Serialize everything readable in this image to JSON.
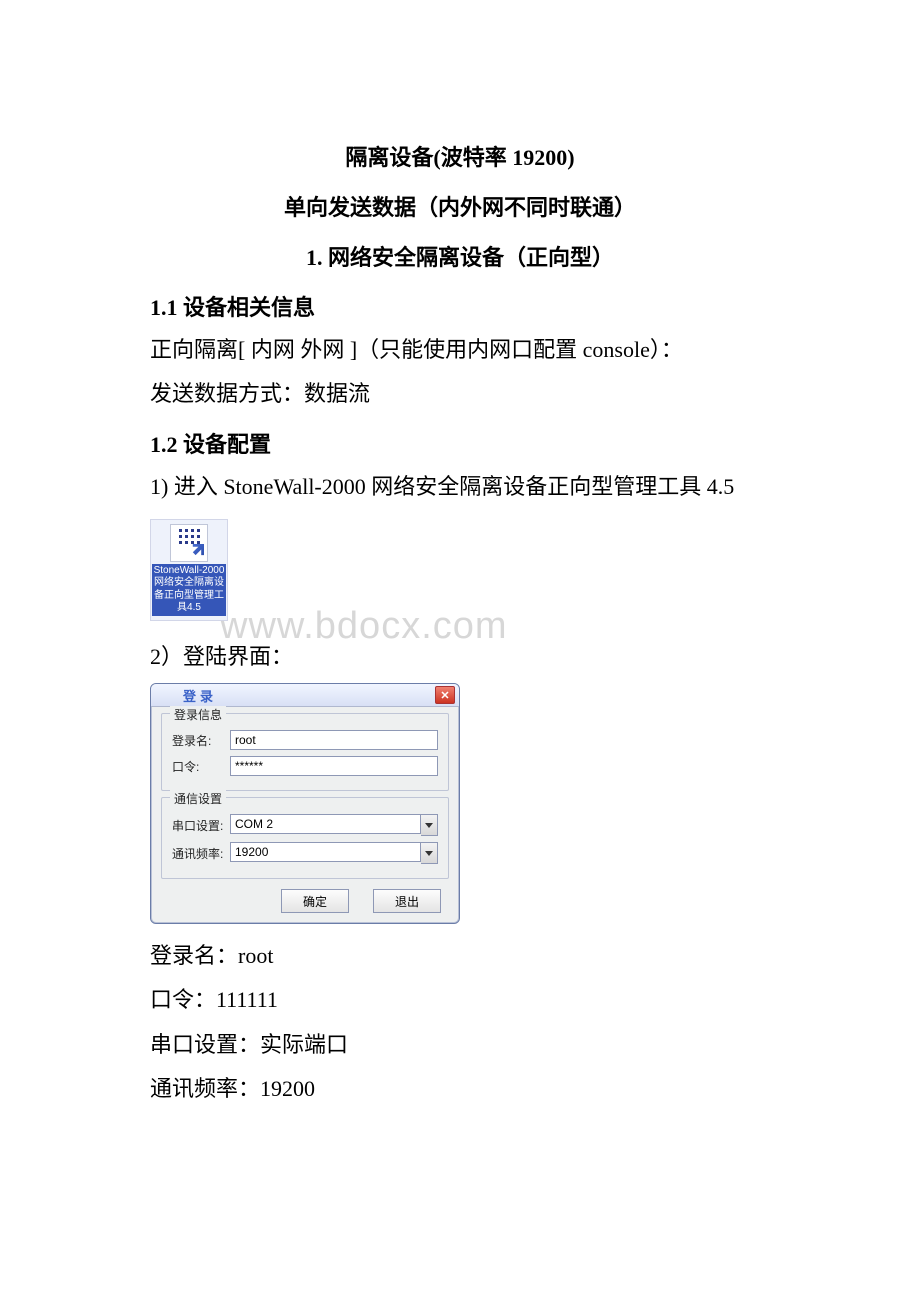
{
  "doc": {
    "title1": "隔离设备(波特率 19200)",
    "title2": "单向发送数据（内外网不同时联通）",
    "title3": "1. 网络安全隔离设备（正向型）",
    "h_1_1": "1.1 设备相关信息",
    "p_1_1a": "正向隔离[ 内网  外网 ]（只能使用内网口配置 console）：",
    "p_1_1b": "发送数据方式：数据流",
    "h_1_2": "1.2 设备配置",
    "p_1_2a": "1) 进入 StoneWall-2000 网络安全隔离设备正向型管理工具 4.5",
    "p_1_2b": "2）登陆界面：",
    "p_login_name": "登录名：root",
    "p_password": "口令：111111",
    "p_com": "串口设置：实际端口",
    "p_baud": "通讯频率：19200"
  },
  "watermark": "www.bdocx.com",
  "desktop_icon": {
    "label": "StoneWall-2000网络安全隔离设备正向型管理工具4.5"
  },
  "dialog": {
    "title": "登录",
    "close": "✕",
    "group_login": "登录信息",
    "login_label": "登录名:",
    "login_value": "root",
    "pwd_label": "口令:",
    "pwd_value": "******",
    "group_comm": "通信设置",
    "com_label": "串口设置:",
    "com_value": "COM 2",
    "baud_label": "通讯频率:",
    "baud_value": "19200",
    "ok": "确定",
    "cancel": "退出"
  }
}
